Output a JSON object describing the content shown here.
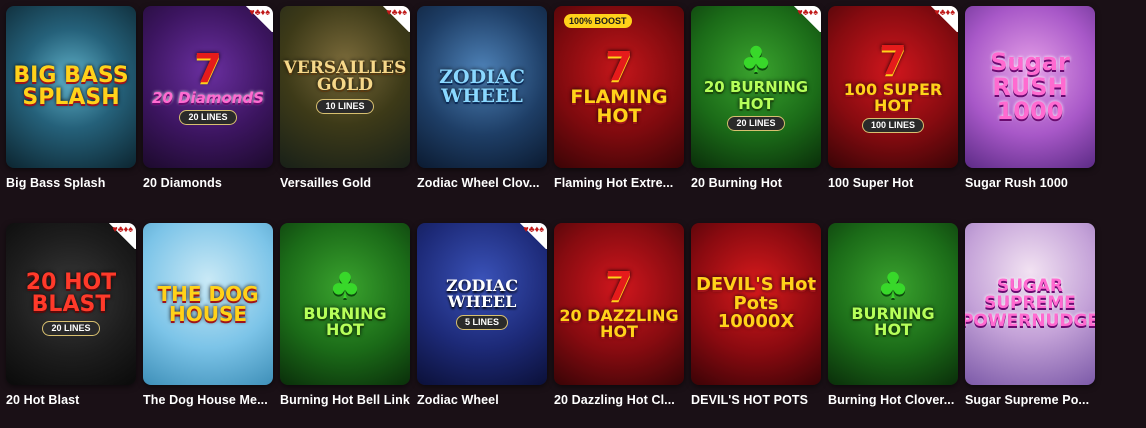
{
  "games_row1": [
    {
      "title": "Big Bass Splash",
      "art": "BIG BASS SPLASH",
      "art_sub": "",
      "badge": "",
      "corner": false
    },
    {
      "title": "20 Diamonds",
      "art": "20 DiamondS",
      "art_sub": "20 LINES",
      "badge": "",
      "corner": true
    },
    {
      "title": "Versailles Gold",
      "art": "VERSAILLES GOLD",
      "art_sub": "10 LINES",
      "badge": "",
      "corner": true
    },
    {
      "title": "Zodiac Wheel Clov...",
      "art": "ZODIAC WHEEL",
      "art_sub": "",
      "badge": "",
      "corner": false
    },
    {
      "title": "Flaming Hot Extre...",
      "art": "FLAMING HOT",
      "art_sub": "",
      "badge": "100% BOOST",
      "corner": false
    },
    {
      "title": "20 Burning Hot",
      "art": "20 BURNING HOT",
      "art_sub": "20 LINES",
      "badge": "",
      "corner": true
    },
    {
      "title": "100 Super Hot",
      "art": "100 SUPER HOT",
      "art_sub": "100 LINES",
      "badge": "",
      "corner": true
    },
    {
      "title": "Sugar Rush 1000",
      "art": "Sugar RUSH 1000",
      "art_sub": "",
      "badge": "",
      "corner": false
    }
  ],
  "games_row2": [
    {
      "title": "20 Hot Blast",
      "art": "20 HOT BLAST",
      "art_sub": "20 LINES",
      "badge": "",
      "corner": true
    },
    {
      "title": "The Dog House Me...",
      "art": "THE DOG HOUSE",
      "art_sub": "",
      "badge": "",
      "corner": false
    },
    {
      "title": "Burning Hot Bell Link",
      "art": "BURNING HOT",
      "art_sub": "",
      "badge": "",
      "corner": false
    },
    {
      "title": "Zodiac Wheel",
      "art": "ZODIAC WHEEL",
      "art_sub": "5 LINES",
      "badge": "",
      "corner": true
    },
    {
      "title": "20 Dazzling Hot Cl...",
      "art": "20 DAZZLING HOT",
      "art_sub": "",
      "badge": "",
      "corner": false
    },
    {
      "title": "DEVIL'S HOT POTS",
      "art": "DEVIL'S Hot Pots 10000X",
      "art_sub": "",
      "badge": "",
      "corner": false
    },
    {
      "title": "Burning Hot Clover...",
      "art": "BURNING HOT",
      "art_sub": "",
      "badge": "",
      "corner": false
    },
    {
      "title": "Sugar Supreme Po...",
      "art": "SUGAR SUPREME POWERNUDGE",
      "art_sub": "",
      "badge": "",
      "corner": false
    }
  ],
  "corner_suits": "♥♣♦♠",
  "colors": {
    "background": "#1a1016",
    "title": "#ffffff",
    "badge": "#ffd21a"
  }
}
